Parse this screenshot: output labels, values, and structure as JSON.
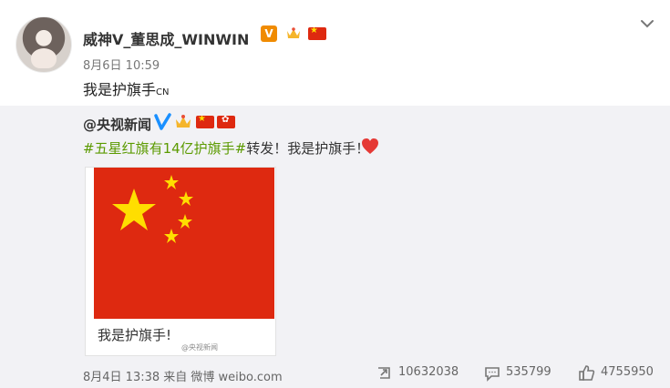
{
  "post": {
    "author": "威神V_董思成_WINWIN",
    "time": "8月6日 10:59",
    "text_main": "我是护旗手",
    "text_suffix": "CN"
  },
  "repost": {
    "author": "@央视新闻",
    "hashtag": "#五星红旗有14亿护旗手#",
    "text": "转发！我是护旗手！",
    "image_caption": "我是护旗手!",
    "image_watermark": "@央视新闻"
  },
  "footer": {
    "date_source": "8月4日 13:38 来自 微博 weibo.com",
    "reposts": "10632038",
    "comments": "535799",
    "likes": "4755950"
  },
  "colors": {
    "hashtag": "#5b9a00",
    "flag_red": "#de2910",
    "flag_yellow": "#ffde00",
    "repost_bg": "#f2f2f5"
  },
  "icons": {
    "verified": "orange-v-icon",
    "blue_verified": "blue-v-icon",
    "crown": "crown-icon",
    "flag": "china-flag-icon",
    "hong_kong_flag": "hong-kong-flag-icon",
    "heart": "heart-icon",
    "repost": "repost-icon",
    "comment": "comment-icon",
    "like": "like-icon",
    "menu": "chevron-down-icon"
  }
}
